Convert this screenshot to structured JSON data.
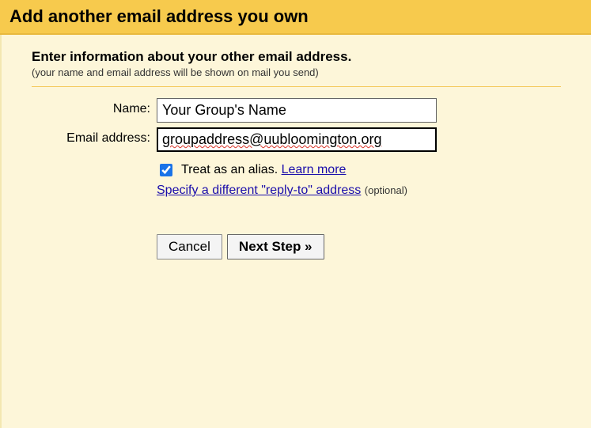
{
  "header": {
    "title": "Add another email address you own"
  },
  "intro": {
    "title": "Enter information about your other email address.",
    "subtitle": "(your name and email address will be shown on mail you send)"
  },
  "form": {
    "name_label": "Name:",
    "name_value": "Your Group's Name",
    "email_label": "Email address:",
    "email_value": "groupaddress@uubloomington.org",
    "alias_checked": true,
    "alias_text": "Treat as an alias.",
    "learn_more": "Learn more",
    "reply_to_link": "Specify a different \"reply-to\" address",
    "optional": "(optional)"
  },
  "buttons": {
    "cancel": "Cancel",
    "next": "Next Step »"
  }
}
